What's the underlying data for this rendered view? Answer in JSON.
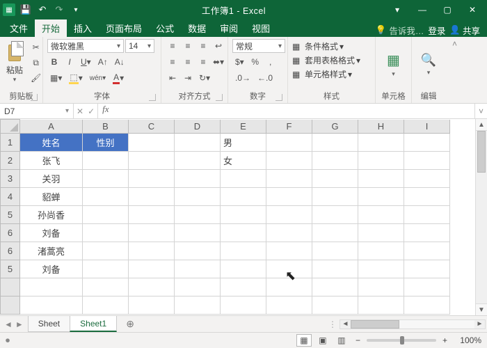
{
  "title": "工作簿1 - Excel",
  "qat": {
    "save": "💾",
    "undo": "↶",
    "redo": "↷"
  },
  "win": {
    "min": "—",
    "max": "▢",
    "close": "✕",
    "ribbonmode": "▾"
  },
  "ribbon": {
    "tabs": [
      "文件",
      "开始",
      "插入",
      "页面布局",
      "公式",
      "数据",
      "审阅",
      "视图"
    ],
    "active": 1,
    "tell": "告诉我…",
    "signin": "登录",
    "share": "共享"
  },
  "groups": {
    "clipboard": {
      "label": "剪贴板",
      "paste": "粘贴"
    },
    "font": {
      "label": "字体",
      "fontname": "微软雅黑",
      "fontsize": "14"
    },
    "align": {
      "label": "对齐方式"
    },
    "number": {
      "label": "数字",
      "format": "常规"
    },
    "styles": {
      "label": "样式",
      "cond": "条件格式",
      "table": "套用表格格式",
      "cell": "单元格样式"
    },
    "cells": {
      "label": "单元格"
    },
    "editing": {
      "label": "编辑"
    }
  },
  "namebox": "D7",
  "columns": [
    "A",
    "B",
    "C",
    "D",
    "E",
    "F",
    "G",
    "H",
    "I"
  ],
  "rows": [
    "1",
    "2",
    "3",
    "4",
    "5",
    "6",
    "6",
    "5"
  ],
  "cells": {
    "A1": "姓名",
    "B1": "性别",
    "E1": "男",
    "A2": "张飞",
    "E2": "女",
    "A3": "关羽",
    "A4": "貂蝉",
    "A5": "孙尚香",
    "A6": "刘备",
    "A7": "渚蒿亮",
    "A8": "刘备"
  },
  "sheets": {
    "tabs": [
      "Sheet",
      "Sheet1"
    ],
    "active": 1
  },
  "zoom": "100%"
}
